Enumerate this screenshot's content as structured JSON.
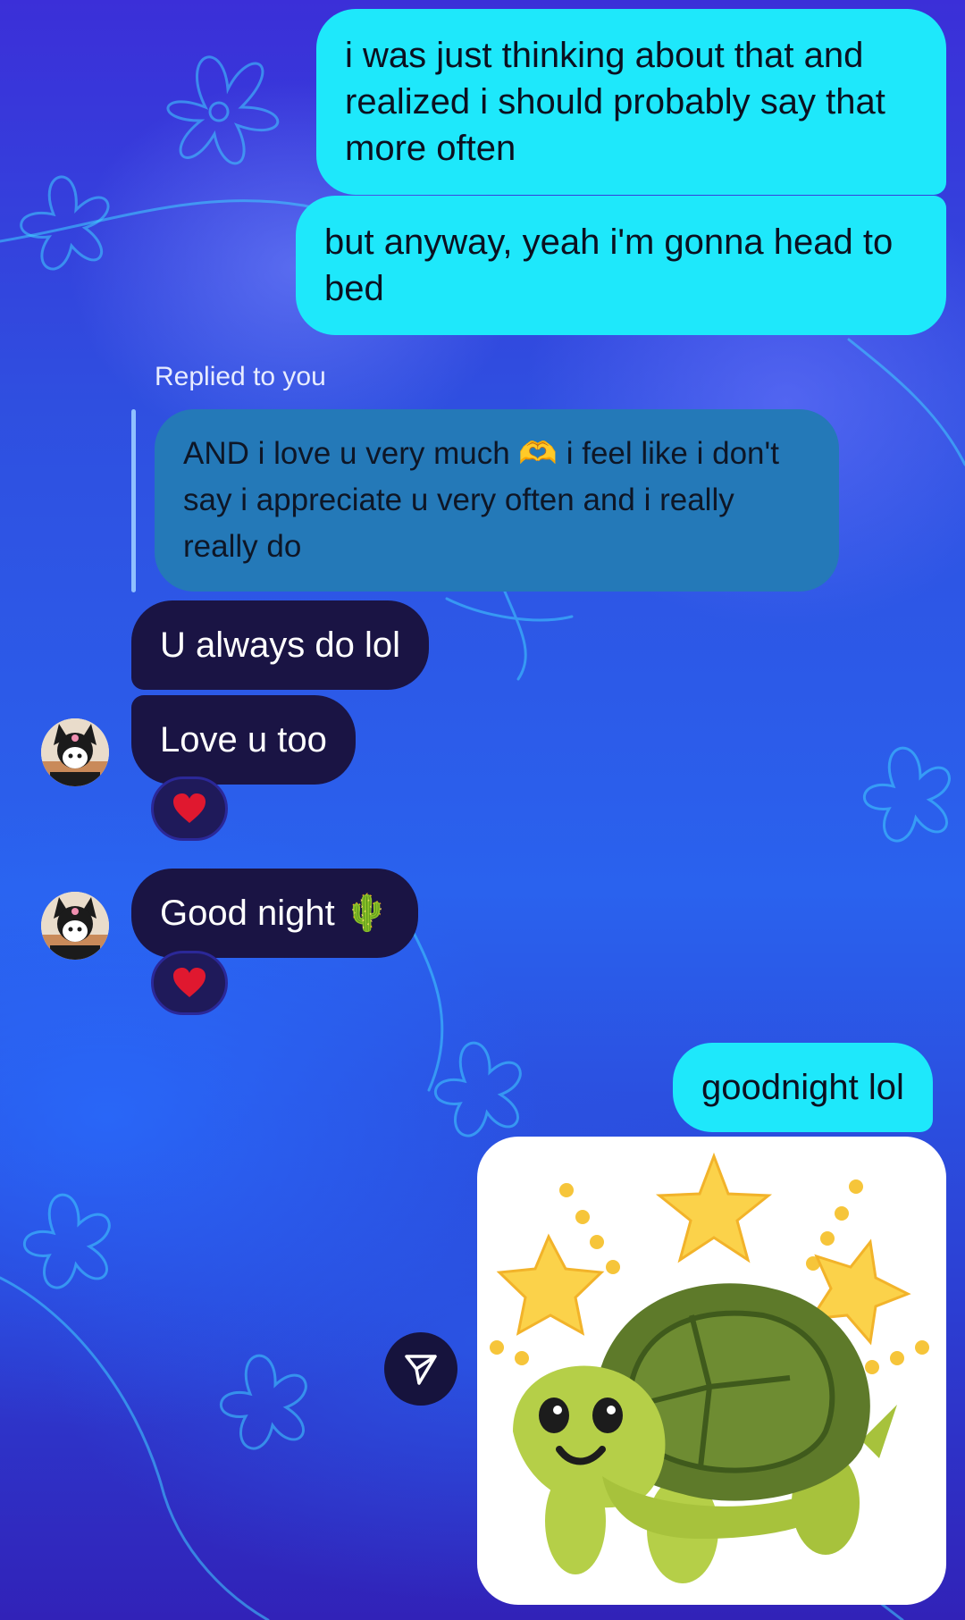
{
  "messages": {
    "out_1": "i was just thinking about that and realized i should probably say that more often",
    "out_2": "but anyway, yeah i'm gonna head to bed",
    "reply_label": "Replied to you",
    "reply_quote_before": "AND i love u very much ",
    "reply_quote_emoji": "🫶",
    "reply_quote_after": " i feel like i don't say i appreciate u very often and i really really do",
    "in_1": "U always do lol",
    "in_2": "Love u too",
    "in_3": "Good night",
    "in_3_emoji": "🌵",
    "out_3": "goodnight lol"
  },
  "reactions": {
    "love_u_too": "❤️",
    "good_night": "❤️"
  },
  "colors": {
    "outgoing_bubble": "#1ee8fb",
    "incoming_bubble": "#1a1444",
    "reply_bubble": "#2479b8",
    "heart": "#e0182f"
  },
  "icons": {
    "avatar": "kuromi-avatar",
    "share": "send-paper-plane-icon",
    "sticker": "turtle-with-stars-sticker"
  }
}
